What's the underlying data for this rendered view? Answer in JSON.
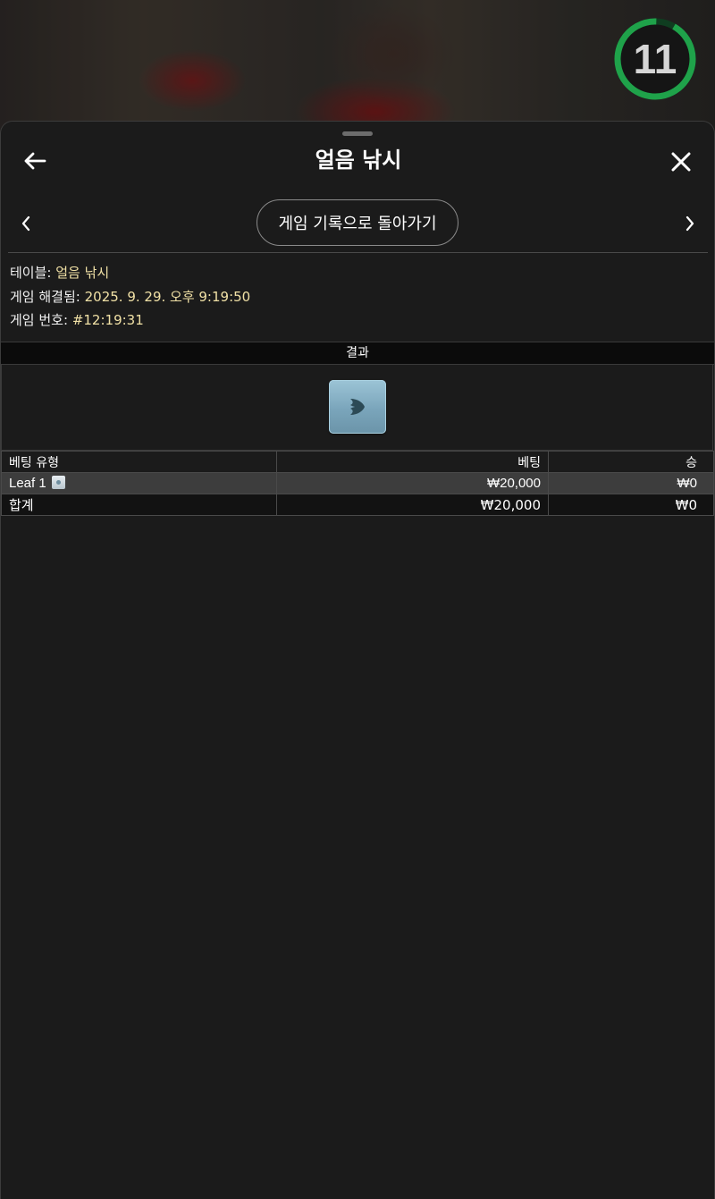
{
  "timer": {
    "value": "11",
    "progress": 0.92,
    "color": "#1fa24a"
  },
  "header": {
    "title": "얼음 낚시",
    "history_button_label": "게임 기록으로 돌아가기"
  },
  "info": {
    "table_label": "테이블:",
    "table_value": "얼음 낚시",
    "resolved_label": "게임 해결됨:",
    "resolved_value": "2025. 9. 29. 오후 9:19:50",
    "game_number_label": "게임 번호:",
    "game_number_value": "#12:19:31"
  },
  "result": {
    "header": "결과",
    "tile_icon": "leaf-tile-icon"
  },
  "bets_table": {
    "headers": {
      "type": "베팅 유형",
      "bet": "베팅",
      "win": "승"
    },
    "rows": [
      {
        "type": "Leaf 1",
        "bet": "₩20,000",
        "win": "₩0"
      }
    ],
    "total": {
      "label": "합계",
      "bet": "₩20,000",
      "win": "₩0"
    }
  },
  "colors": {
    "accent_value": "#f1e1a6",
    "panel_bg": "#1b1b1b"
  }
}
